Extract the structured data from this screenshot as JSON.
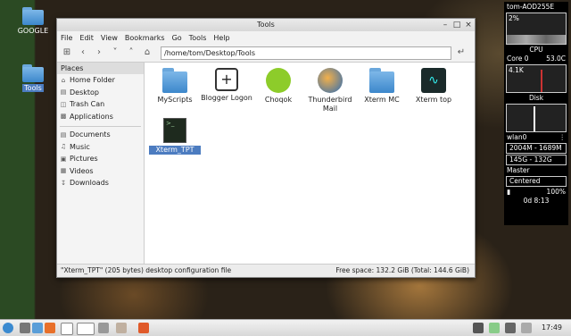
{
  "desktop": {
    "icons": [
      {
        "label": "GOOGLE"
      },
      {
        "label": "Tools"
      }
    ]
  },
  "window": {
    "title": "Tools",
    "menu": [
      "File",
      "Edit",
      "View",
      "Bookmarks",
      "Go",
      "Tools",
      "Help"
    ],
    "path": "/home/tom/Desktop/Tools",
    "sidebar": {
      "header": "Places",
      "items": [
        {
          "label": "Home Folder",
          "icon": "home-icon"
        },
        {
          "label": "Desktop",
          "icon": "desktop-icon"
        },
        {
          "label": "Trash Can",
          "icon": "trash-icon"
        },
        {
          "label": "Applications",
          "icon": "applications-icon"
        },
        {
          "label": "Documents",
          "icon": "documents-icon"
        },
        {
          "label": "Music",
          "icon": "music-icon"
        },
        {
          "label": "Pictures",
          "icon": "pictures-icon"
        },
        {
          "label": "Videos",
          "icon": "videos-icon"
        },
        {
          "label": "Downloads",
          "icon": "downloads-icon"
        }
      ]
    },
    "files": [
      {
        "label": "MyScripts",
        "icon": "folder-icon"
      },
      {
        "label": "Blogger Logon",
        "icon": "blogger-icon"
      },
      {
        "label": "Choqok",
        "icon": "choqok-icon"
      },
      {
        "label": "Thunderbird Mail",
        "icon": "thunderbird-icon"
      },
      {
        "label": "Xterm MC",
        "icon": "folder-icon"
      },
      {
        "label": "Xterm top",
        "icon": "monitor-icon"
      },
      {
        "label": "Xterm_TPT",
        "icon": "terminal-icon"
      }
    ],
    "status_left": "\"Xterm_TPT\" (205 bytes) desktop configuration file",
    "status_right": "Free space: 132.2 GiB (Total: 144.6 GiB)"
  },
  "conky": {
    "host": "tom-AOD255E",
    "cpu_pct": "2%",
    "cpu_label": "CPU",
    "core_label": "Core 0",
    "core_temp": "53.0C",
    "ram": "4.1K",
    "disk_label": "Disk",
    "net": "wlan0",
    "mem": "2004M - 1689M",
    "disk_usage": "145G - 132G",
    "vol_label": "Master",
    "vol_mode": "Centered",
    "battery": "100%",
    "uptime": "0d   8:13"
  },
  "taskbar": {
    "clock": "17:49"
  },
  "colors": {
    "accent": "#4c7cc0",
    "folder": "#5a9ed8"
  }
}
